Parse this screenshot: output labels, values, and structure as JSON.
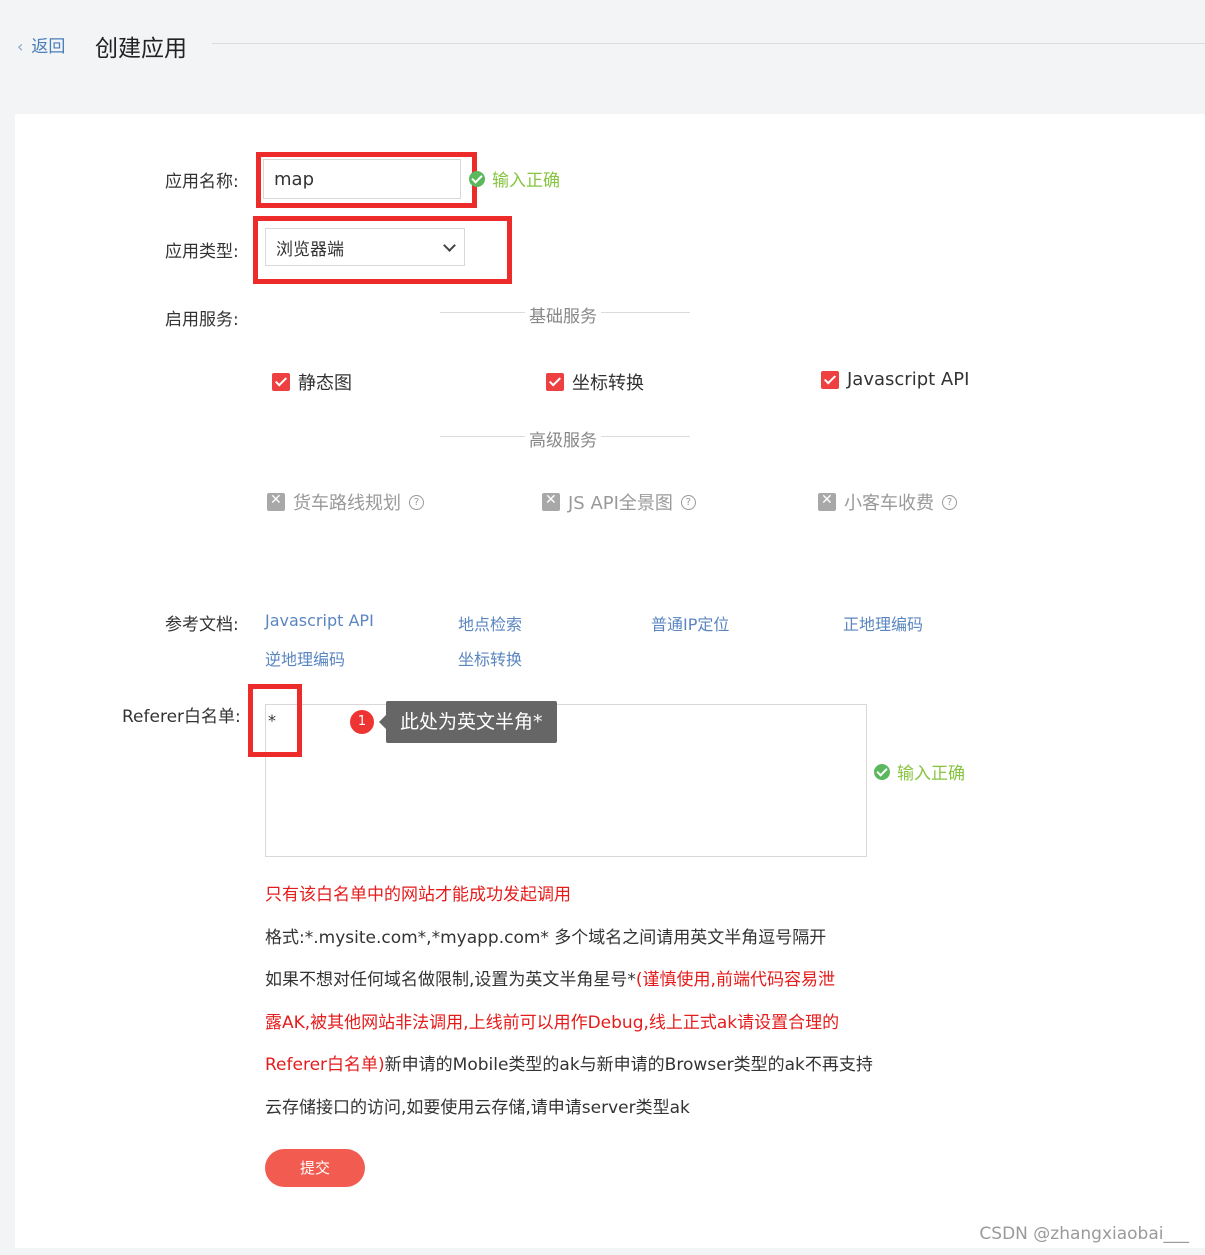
{
  "header": {
    "back_label": "返回",
    "title": "创建应用"
  },
  "form": {
    "app_name": {
      "label": "应用名称:",
      "value": "map",
      "status": "输入正确"
    },
    "app_type": {
      "label": "应用类型:",
      "selected": "浏览器端"
    },
    "services": {
      "label": "启用服务:",
      "basic_title": "基础服务",
      "basic": [
        "静态图",
        "坐标转换",
        "Javascript API"
      ],
      "advanced_title": "高级服务",
      "advanced": [
        "货车路线规划",
        "JS API全景图",
        "小客车收费"
      ],
      "help_glyph": "?"
    },
    "docs": {
      "label": "参考文档:",
      "links": [
        "Javascript API",
        "地点检索",
        "普通IP定位",
        "正地理编码",
        "逆地理编码",
        "坐标转换"
      ]
    },
    "referer": {
      "label": "Referer白名单:",
      "value": "*",
      "status": "输入正确",
      "annotation_number": "1",
      "annotation_text": "此处为英文半角*"
    },
    "notes": {
      "warning": "只有该白名单中的网站才能成功发起调用",
      "format": "格式:*.mysite.com*,*myapp.com* 多个域名之间请用英文半角逗号隔开",
      "line3_black": "如果不想对任何域名做限制,设置为英文半角星号*",
      "line3_red": "(谨慎使用,前端代码容易泄",
      "line4_red": "露AK,被其他网站非法调用,上线前可以用作Debug,线上正式ak请设置合理的",
      "line5_red": "Referer白名单)",
      "line5_black": "新申请的Mobile类型的ak与新申请的Browser类型的ak不再支持",
      "line6": "云存储接口的访问,如要使用云存储,请申请server类型ak"
    },
    "submit_label": "提交"
  },
  "watermark": "CSDN @zhangxiaobai___",
  "colors": {
    "accent_red": "#ee2b2b",
    "success_green": "#87c540",
    "link_blue": "#5a86c0"
  }
}
